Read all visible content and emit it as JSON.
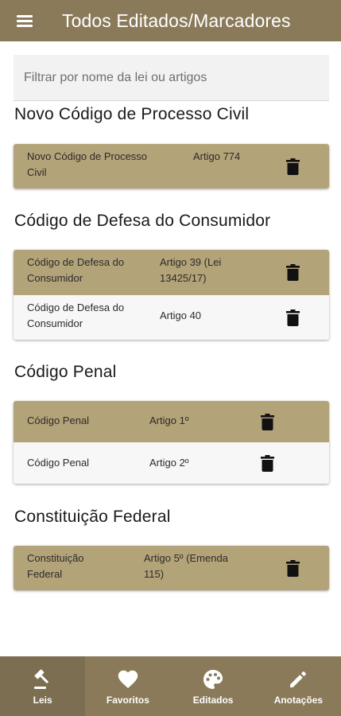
{
  "appbar": {
    "title": "Todos Editados/Marcadores"
  },
  "search": {
    "placeholder": "Filtrar por nome da lei ou artigos"
  },
  "sections": [
    {
      "title": "Novo Código de Processo Civil",
      "rows": [
        {
          "name": "Novo Código de Processo Civil",
          "article": "Artigo 774"
        }
      ]
    },
    {
      "title": "Código de Defesa do Consumidor",
      "rows": [
        {
          "name": "Código de Defesa do Consumidor",
          "article": "Artigo 39 (Lei 13425/17)"
        },
        {
          "name": "Código de Defesa do Consumidor",
          "article": "Artigo 40"
        }
      ]
    },
    {
      "title": "Código Penal",
      "rows": [
        {
          "name": "Código Penal",
          "article": "Artigo 1º"
        },
        {
          "name": "Código Penal",
          "article": "Artigo 2º"
        }
      ]
    },
    {
      "title": "Constituição Federal",
      "rows": [
        {
          "name": "Constituição Federal",
          "article": "Artigo 5º (Emenda 115)"
        }
      ]
    }
  ],
  "bottom_nav": [
    {
      "label": "Leis",
      "icon": "gavel-icon"
    },
    {
      "label": "Favoritos",
      "icon": "heart-icon"
    },
    {
      "label": "Editados",
      "icon": "palette-icon"
    },
    {
      "label": "Anotações",
      "icon": "pencil-icon"
    }
  ],
  "colors": {
    "appbar": "#8a7a5a",
    "row_highlight": "#b3a378",
    "row_normal": "#f7f7f7",
    "nav_active": "#7c6e50"
  }
}
